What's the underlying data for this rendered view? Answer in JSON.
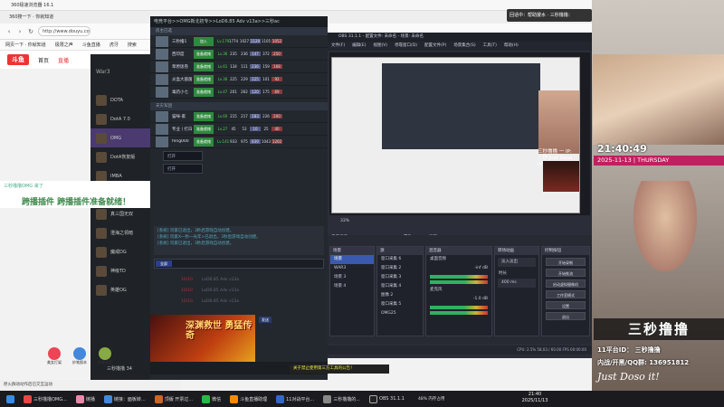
{
  "browser": {
    "title": "360极速浏览器 16.1",
    "tabs": "360搜一下 · 你就知道",
    "address": "http://www.douyu.com/list",
    "bookmarks": [
      "网页一下 · 你就知道",
      "极限之声",
      "斗鱼直播",
      "虎牙",
      "搜索"
    ],
    "site_nav": [
      "首页",
      "直播"
    ],
    "status": "原火群动动作后已交互运动"
  },
  "game_sidebar": {
    "header": "War3",
    "items": [
      "DOTA",
      "DotA 7.0",
      "OMG",
      "DotA恢复版",
      "IMBA",
      "IMCA",
      "真三国无双",
      "澄海之领暗",
      "魔戒DG",
      "神级TD",
      "英雄OG"
    ]
  },
  "chat": {
    "line1": "三秒撸撸OMG 来了",
    "line2": "跨播插件 跨播插件准备就绪！"
  },
  "left_thumbs": [
    "美女打架",
    "妙笔图本",
    "瑶观社区"
  ],
  "game": {
    "title": "电竞平台>>OMG新北初专>>LoD6.85 Adv v13a>>三秒ac",
    "lobby1_header": "房主已选",
    "lobby1": [
      {
        "name": "三秒撸1",
        "lv": "Lv.179",
        "a": "1774",
        "b": "1027",
        "c": "1129",
        "d": "1105",
        "e": "1052"
      },
      {
        "name": "西印度",
        "lv": "Lv.36",
        "a": "235",
        "b": "236",
        "c": "147",
        "d": "372",
        "e": "250"
      },
      {
        "name": "草原饭卷",
        "lv": "Lv.61",
        "a": "134",
        "b": "111",
        "c": "236",
        "d": "159",
        "e": "168"
      },
      {
        "name": "炎盒大菌菌",
        "lv": "Lv.36",
        "a": "225",
        "b": "229",
        "c": "225",
        "d": "101",
        "e": "92"
      },
      {
        "name": "毒药小七",
        "lv": "Lv.47",
        "a": "201",
        "b": "262",
        "c": "120",
        "d": "175",
        "e": "69"
      }
    ],
    "lobby2_header": "天灾军团",
    "lobby2": [
      {
        "name": "猫咪-家",
        "lv": "Lv.60",
        "a": "215",
        "b": "217",
        "c": "183",
        "d": "226",
        "e": "200"
      },
      {
        "name": "专业丨打白",
        "lv": "Lv.27",
        "a": "45",
        "b": "53",
        "c": "10",
        "d": "25",
        "e": "40"
      },
      {
        "name": "feng000",
        "lv": "Lv.141",
        "a": "933",
        "b": "975",
        "c": "839",
        "d": "1043",
        "e": "1202"
      }
    ],
    "join_label": "加入",
    "ready_label": "准备就绪",
    "dropdown": "打开",
    "syslog": [
      "[系统] 玩家已退出，3秒后游戏自动创建。",
      "[系统] 玩家X一秒一光年>已退出，3秒后游戏自动创建。",
      "[系统] 玩家已退出，3秒后游戏自动创建。"
    ],
    "chat_btn": "全部",
    "send_btn": "发送",
    "stats": [
      [
        "10/10",
        "LoD6.85 Adv v13a"
      ],
      [
        "10/10",
        "LoD6.85 Adv v13a"
      ],
      [
        "10/10",
        "LoD6.85 Adv v13a"
      ]
    ],
    "banner": "深渊救世 勇猛传奇",
    "notice": "关于禁止使用第三方工具的公告！",
    "bottom_user": "三秒撸撸 34"
  },
  "obs": {
    "title": "OBS 31.1.1 - 配置文件: 未命名 - 场景: 未命名",
    "menu": [
      "文件(F)",
      "编辑(E)",
      "视图(V)",
      "停靠窗口(D)",
      "配置文件(P)",
      "场景集合(S)",
      "工具(T)",
      "帮助(H)"
    ],
    "toolbar": [
      "未选择源",
      "属性",
      "滤镜"
    ],
    "zoom": "33%",
    "docks": {
      "scenes": {
        "title": "场景",
        "items": [
          "场景",
          "WAR3",
          "场景 3",
          "场景 4"
        ]
      },
      "sources": {
        "title": "源",
        "items": [
          "窗口采集 6",
          "窗口采集 2",
          "窗口采集 3",
          "窗口采集 4",
          "图像 2",
          "窗口采集 5",
          "OMG25"
        ]
      },
      "mixer": {
        "title": "混音器",
        "tracks": [
          {
            "name": "桌面音频",
            "db": "-inf dB"
          },
          {
            "name": "麦克风",
            "db": "-1.0 dB"
          }
        ]
      },
      "transitions": {
        "title": "转场动画",
        "type": "淡入淡出",
        "duration_label": "时长",
        "duration": "400 ms"
      },
      "controls": {
        "title": "控制按钮",
        "buttons": [
          "开始录制",
          "开始推流",
          "启动虚拟摄像机",
          "工作室模式",
          "设置",
          "退出"
        ]
      }
    },
    "status": "CPU: 2.5%  58.03 / 60.00 FPS  00:00:00"
  },
  "overlay": {
    "top_notice": "回话中：帮助援水 · 三秒撸撸：",
    "clock": "21:40:49",
    "date": "2025-11-13 | THURSDAY",
    "name": "三秒撸撸",
    "platform": "11平台ID： 三秒撸撸",
    "contact": "内战/开黑/QQ群: 136951812",
    "signature": "Just Doso it!",
    "small_sig": "三秒撸撸 一 IP: 三秒 Just Doso it!"
  },
  "taskbar": {
    "items": [
      "三秒撸撸OMG...",
      "链播",
      "链接：面板转...",
      "顶版 开票过...",
      "微信",
      "斗鱼直播助理",
      "11对战平台...",
      "三秒撸撸的...",
      "OBS 31.1.1"
    ],
    "weather": "48% 内存占用",
    "time": "21:40",
    "date": "2025/11/13"
  }
}
